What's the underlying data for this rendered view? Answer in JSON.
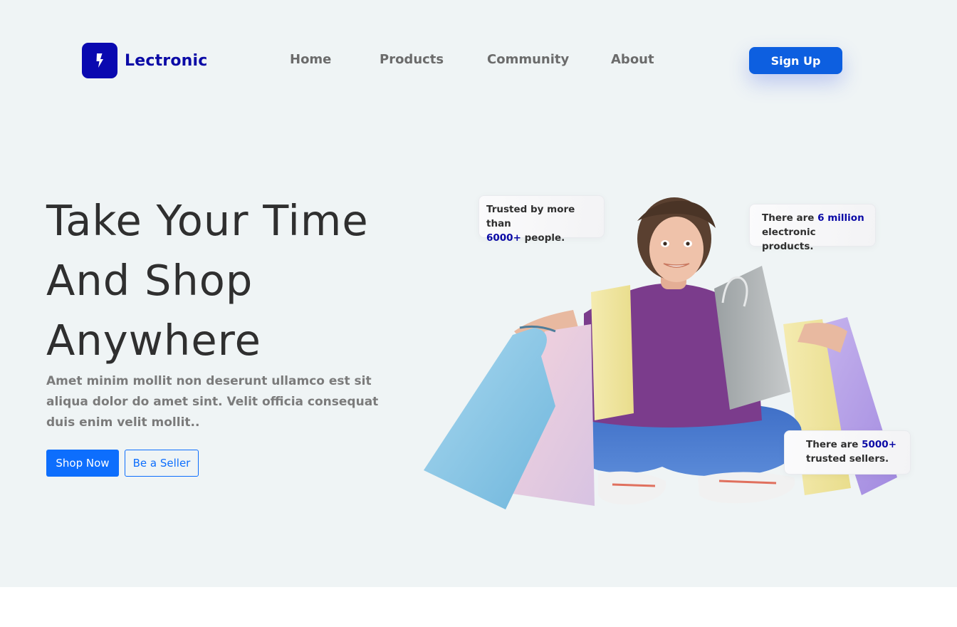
{
  "brand": {
    "name": "Lectronic",
    "icon": "lightning-bolt-icon",
    "color": "#0a09b0"
  },
  "nav": {
    "items": [
      "Home",
      "Products",
      "Community",
      "About"
    ]
  },
  "signup_label": "Sign Up",
  "hero": {
    "headline": [
      "Take Your Time",
      "And Shop",
      "Anywhere"
    ],
    "description": "Amet minim mollit non deserunt ullamco est sit aliqua dolor do amet sint. Velit officia consequat duis enim velit mollit..",
    "primary_button": "Shop Now",
    "secondary_button": "Be a Seller",
    "image": "woman-with-shopping-bags"
  },
  "stats": {
    "trusted": {
      "prefix": "Trusted by more than",
      "value": "6000+",
      "suffix": "people."
    },
    "products": {
      "prefix": "There are",
      "value": "6 million",
      "suffix": "electronic products."
    },
    "sellers": {
      "prefix": "There are",
      "value": "5000+",
      "suffix": "trusted sellers."
    }
  },
  "colors": {
    "accent": "#0d6efd",
    "brand_dark": "#0b0aa6",
    "hero_bg": "#eff4f5",
    "signup": "#0d5fe0"
  }
}
